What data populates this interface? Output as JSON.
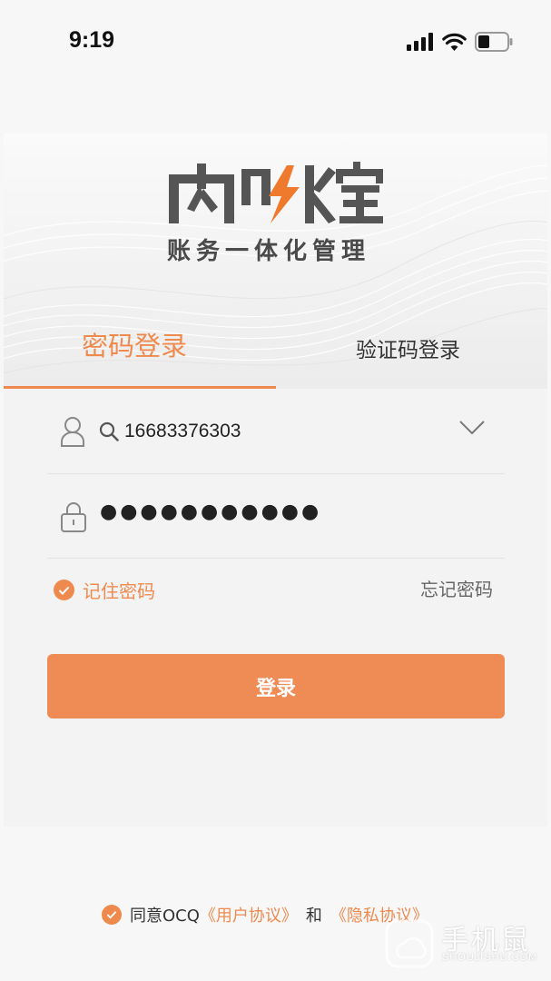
{
  "status_bar": {
    "time": "9:19",
    "icons": [
      "cellular-signal-icon",
      "wifi-icon",
      "battery-icon"
    ]
  },
  "brand": {
    "logo_text": "内账宝",
    "slogan": "账务一体化管理",
    "accent_color": "#ef8a4f"
  },
  "tabs": [
    {
      "label": "密码登录",
      "active": true
    },
    {
      "label": "验证码登录",
      "active": false
    }
  ],
  "form": {
    "account_value": "16683376303",
    "password_mask": "●●●●●●●●●●●",
    "remember_label": "记住密码",
    "remember_checked": true,
    "forgot_label": "忘记密码",
    "login_label": "登录"
  },
  "agreement": {
    "checked": true,
    "prefix": "同意OCQ",
    "user_agreement": "《用户协议》",
    "conjunction": "和",
    "privacy_policy": "《隐私协议》"
  },
  "watermark": {
    "title": "手机鼠",
    "subtitle": "SHOUJISHU.COM"
  }
}
